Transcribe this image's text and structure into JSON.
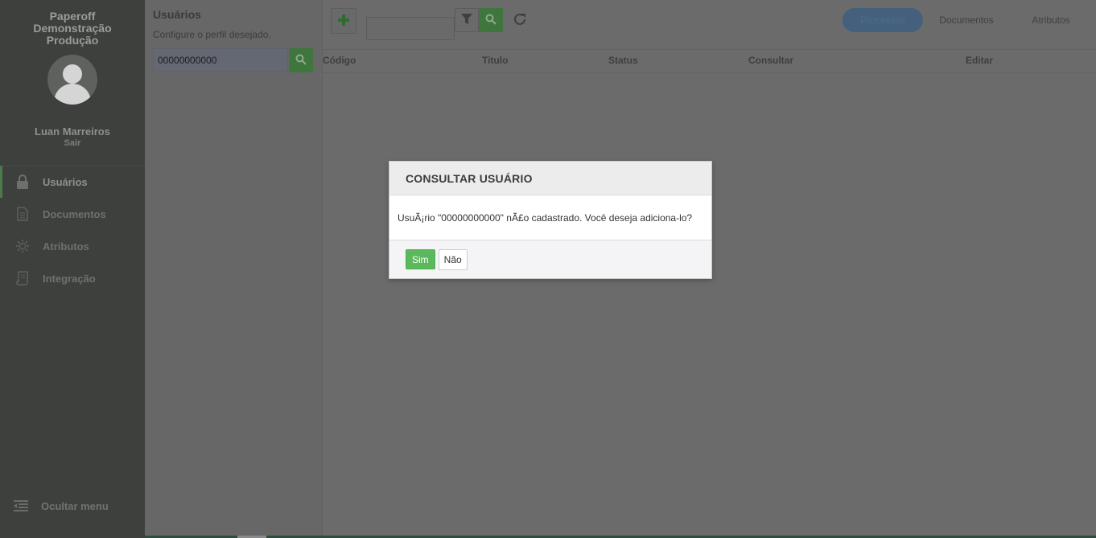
{
  "sidebar": {
    "brand": "Paperoff Demonstração Produção",
    "user_name": "Luan Marreiros",
    "logout_label": "Sair",
    "items": [
      {
        "label": "Usuários",
        "icon": "lock-icon",
        "active": true
      },
      {
        "label": "Documentos",
        "icon": "document-icon",
        "active": false
      },
      {
        "label": "Atributos",
        "icon": "gear-icon",
        "active": false
      },
      {
        "label": "Integração",
        "icon": "scroll-icon",
        "active": false
      }
    ],
    "hide_menu_label": "Ocultar menu"
  },
  "panel": {
    "title": "Usuários",
    "subtitle": "Configure o perfil desejado.",
    "search_value": "00000000000"
  },
  "main": {
    "tabs": [
      {
        "label": "Processos",
        "active": true
      },
      {
        "label": "Documentos",
        "active": false
      },
      {
        "label": "Atributos",
        "active": false
      }
    ],
    "columns": [
      "Código",
      "Titulo",
      "Status",
      "Consultar",
      "Editar"
    ]
  },
  "modal": {
    "title": "CONSULTAR USUÁRIO",
    "message": "UsuÃ¡rio \"00000000000\" nÃ£o cadastrado. Você deseja adiciona-lo?",
    "yes_label": "Sim",
    "no_label": "Não"
  },
  "colors": {
    "accent_green": "#5cb85c",
    "sidebar_bg": "#3d403d",
    "overlay": "#6b6b6b"
  }
}
